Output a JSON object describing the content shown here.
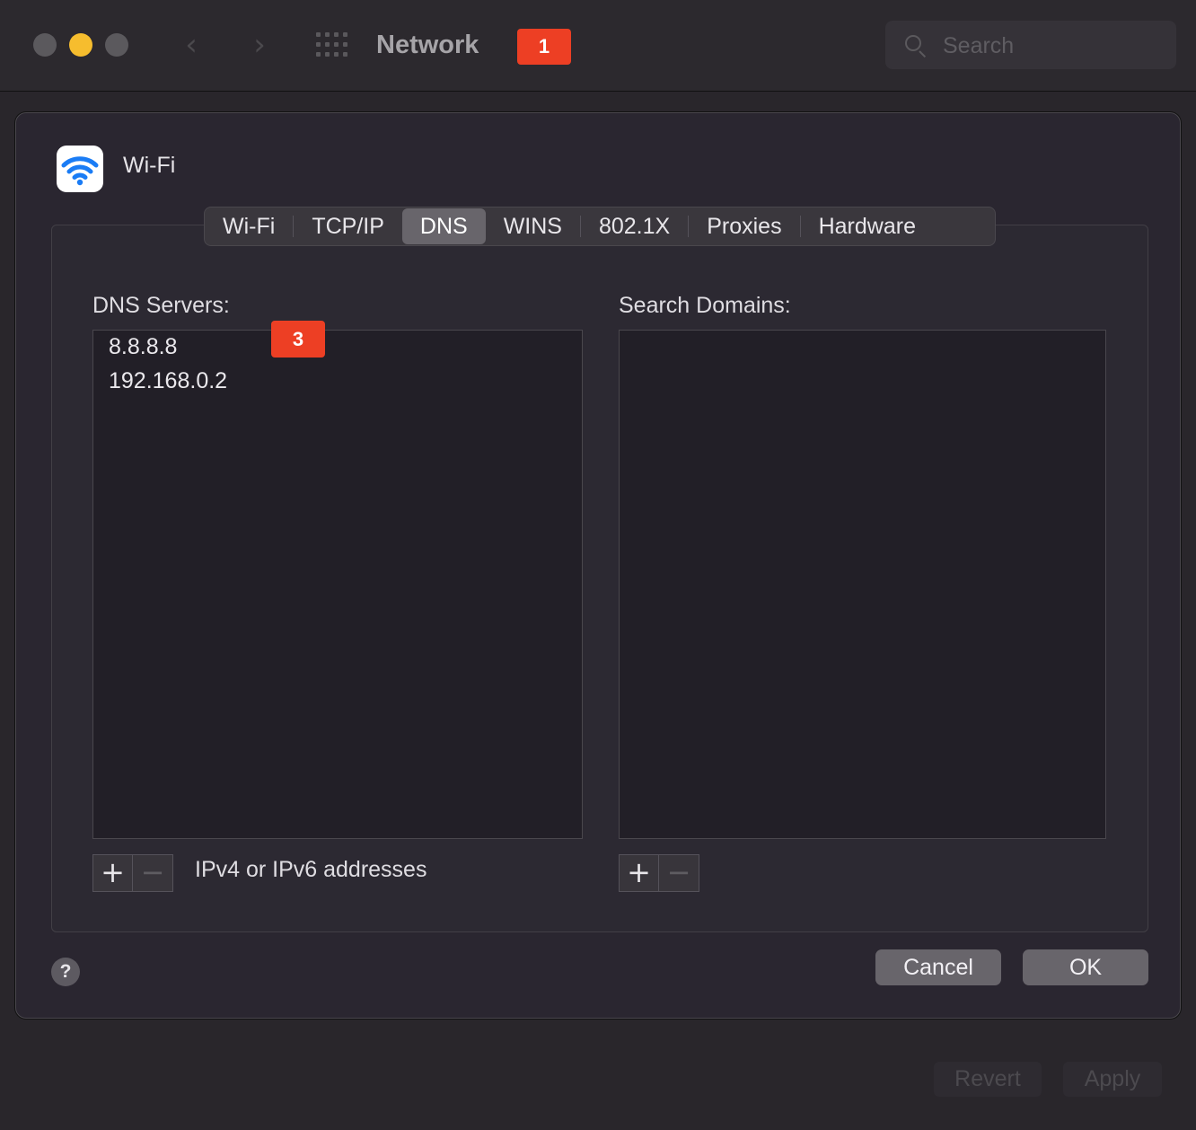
{
  "window": {
    "title": "Network",
    "search_placeholder": "Search"
  },
  "badges": {
    "title_badge": "1",
    "dns_badge": "3"
  },
  "sheet": {
    "title": "Wi-Fi",
    "tabs": [
      {
        "label": "Wi-Fi",
        "active": false
      },
      {
        "label": "TCP/IP",
        "active": false
      },
      {
        "label": "DNS",
        "active": true
      },
      {
        "label": "WINS",
        "active": false
      },
      {
        "label": "802.1X",
        "active": false
      },
      {
        "label": "Proxies",
        "active": false
      },
      {
        "label": "Hardware",
        "active": false
      }
    ],
    "dns_servers": {
      "label": "DNS Servers:",
      "items": [
        "8.8.8.8",
        "192.168.0.2"
      ],
      "hint": "IPv4 or IPv6 addresses"
    },
    "search_domains": {
      "label": "Search Domains:",
      "items": []
    },
    "plus": "+",
    "minus": "−",
    "help": "?",
    "cancel_label": "Cancel",
    "ok_label": "OK"
  },
  "footer": {
    "revert_label": "Revert",
    "apply_label": "Apply"
  },
  "colors": {
    "accent_badge": "#ed3f24",
    "wifi_icon": "#1a7cf5"
  }
}
